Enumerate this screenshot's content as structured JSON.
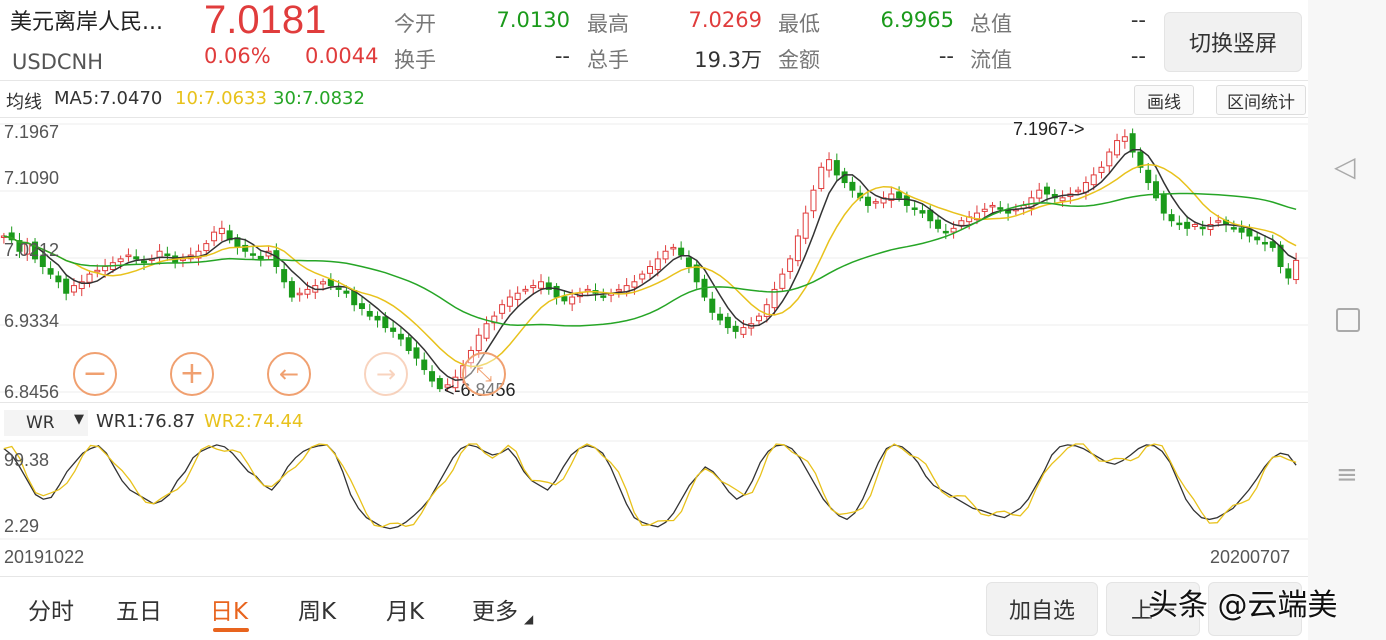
{
  "header": {
    "title": "美元离岸人民...",
    "symbol": "USDCNH",
    "price": "7.0181",
    "change_pct": "0.06%",
    "change_abs": "0.0044",
    "stats": [
      {
        "label": "今开",
        "value": "7.0130"
      },
      {
        "label": "最高",
        "value": "7.0269"
      },
      {
        "label": "最低",
        "value": "6.9965"
      },
      {
        "label": "总值",
        "value": "--"
      },
      {
        "label": "换手",
        "value": "--"
      },
      {
        "label": "总手",
        "value": "19.3万"
      },
      {
        "label": "金额",
        "value": "--"
      },
      {
        "label": "流值",
        "value": "--"
      }
    ],
    "switch_button": "切换竖屏"
  },
  "ma_bar": {
    "label": "均线",
    "ma5": "MA5:7.0470",
    "ma10": "10:7.0633",
    "ma30": "30:7.0832",
    "draw_button": "画线",
    "stats_button": "区间统计"
  },
  "price_axis": [
    "7.1967",
    "7.1090",
    "7.0212",
    "6.9334",
    "6.8456"
  ],
  "annotations": {
    "high": "7.1967->",
    "low": "<-6.8456"
  },
  "wr_bar": {
    "selector": "WR",
    "wr1": "WR1:76.87",
    "wr2": "WR2:74.44"
  },
  "wr_axis": [
    "99.38",
    "2.29"
  ],
  "dates": {
    "start": "20191022",
    "end": "20200707"
  },
  "tabs": [
    "分时",
    "五日",
    "日K",
    "周K",
    "月K",
    "更多"
  ],
  "bottom_buttons": {
    "add": "加自选",
    "prev": "上一"
  },
  "watermark": "头条 @云端美",
  "colors": {
    "up": "#e03c3c",
    "down": "#1b9a1b",
    "ma5": "#333333",
    "ma10": "#e8c21c",
    "ma30": "#26a526",
    "accent": "#e8641e"
  },
  "chart_data": {
    "type": "candlestick",
    "price_range": [
      6.8456,
      7.1967
    ],
    "high": 7.1967,
    "low": 6.8456,
    "closes": [
      7.05,
      7.045,
      7.03,
      7.04,
      7.02,
      7.01,
      7.0,
      6.99,
      6.975,
      6.985,
      6.99,
      7.0,
      7.005,
      7.01,
      7.015,
      7.02,
      7.025,
      7.02,
      7.015,
      7.02,
      7.03,
      7.025,
      7.015,
      7.02,
      7.025,
      7.03,
      7.04,
      7.055,
      7.06,
      7.045,
      7.035,
      7.03,
      7.025,
      7.02,
      7.03,
      7.01,
      6.99,
      6.97,
      6.975,
      6.98,
      6.985,
      6.99,
      6.985,
      6.98,
      6.975,
      6.96,
      6.955,
      6.945,
      6.94,
      6.93,
      6.925,
      6.915,
      6.9,
      6.89,
      6.875,
      6.86,
      6.85,
      6.855,
      6.865,
      6.88,
      6.9,
      6.92,
      6.935,
      6.945,
      6.96,
      6.97,
      6.975,
      6.98,
      6.985,
      6.99,
      6.98,
      6.97,
      6.965,
      6.97,
      6.975,
      6.98,
      6.975,
      6.97,
      6.975,
      6.98,
      6.985,
      6.99,
      7.0,
      7.01,
      7.02,
      7.03,
      7.035,
      7.025,
      7.01,
      6.99,
      6.97,
      6.95,
      6.94,
      6.93,
      6.925,
      6.93,
      6.935,
      6.945,
      6.96,
      6.98,
      7.0,
      7.02,
      7.05,
      7.08,
      7.11,
      7.14,
      7.15,
      7.13,
      7.12,
      7.11,
      7.1,
      7.09,
      7.095,
      7.1,
      7.105,
      7.1,
      7.09,
      7.085,
      7.08,
      7.07,
      7.06,
      7.055,
      7.06,
      7.07,
      7.075,
      7.08,
      7.085,
      7.09,
      7.085,
      7.08,
      7.085,
      7.09,
      7.1,
      7.11,
      7.105,
      7.1,
      7.1,
      7.105,
      7.11,
      7.12,
      7.13,
      7.14,
      7.16,
      7.175,
      7.18,
      7.16,
      7.14,
      7.12,
      7.1,
      7.08,
      7.07,
      7.065,
      7.06,
      7.065,
      7.06,
      7.065,
      7.07,
      7.065,
      7.06,
      7.055,
      7.05,
      7.045,
      7.04,
      7.035,
      7.01,
      6.995,
      7.018
    ],
    "wr1": [
      95,
      88,
      75,
      60,
      45,
      40,
      42,
      55,
      70,
      80,
      90,
      95,
      98,
      90,
      75,
      60,
      50,
      45,
      40,
      35,
      38,
      45,
      60,
      70,
      85,
      92,
      96,
      99,
      97,
      90,
      80,
      70,
      65,
      55,
      50,
      60,
      75,
      85,
      92,
      96,
      98,
      99,
      90,
      70,
      45,
      30,
      20,
      15,
      10,
      8,
      10,
      15,
      22,
      30,
      40,
      55,
      70,
      85,
      95,
      99,
      97,
      92,
      88,
      90,
      95,
      85,
      70,
      60,
      55,
      50,
      60,
      75,
      88,
      95,
      98,
      96,
      90,
      75,
      55,
      35,
      20,
      15,
      12,
      10,
      15,
      25,
      40,
      55,
      65,
      75,
      70,
      60,
      48,
      40,
      45,
      60,
      80,
      92,
      98,
      99,
      95,
      85,
      70,
      55,
      40,
      30,
      22,
      18,
      25,
      40,
      60,
      80,
      95,
      99,
      97,
      90,
      80,
      65,
      55,
      50,
      45,
      40,
      35,
      30,
      28,
      25,
      22,
      20,
      25,
      30,
      40,
      55,
      70,
      88,
      97,
      99,
      98,
      95,
      90,
      85,
      80,
      78,
      82,
      88,
      95,
      99,
      98,
      92,
      80,
      60,
      40,
      28,
      20,
      18,
      20,
      25,
      30,
      40,
      50,
      62,
      75,
      85,
      90,
      88,
      77
    ]
  }
}
